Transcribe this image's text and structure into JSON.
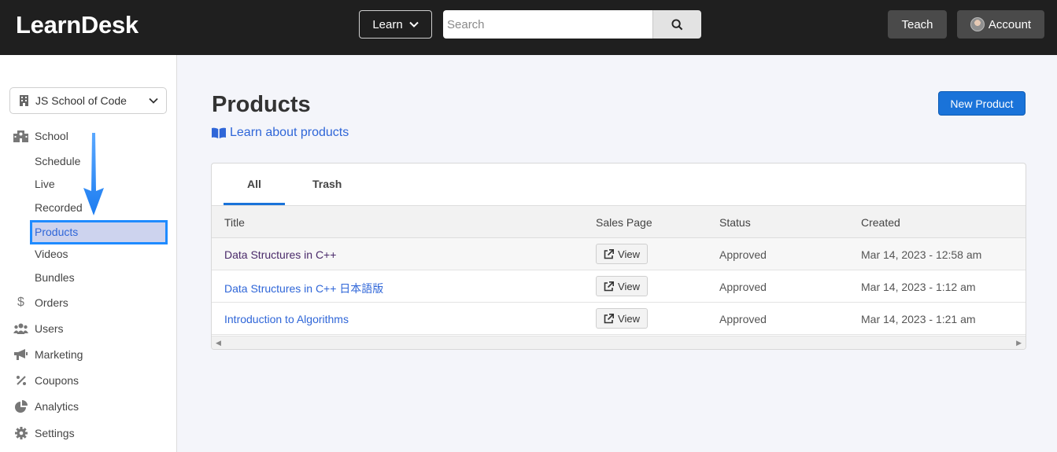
{
  "header": {
    "logo": "LearnDesk",
    "learn_label": "Learn",
    "search_placeholder": "Search",
    "teach_label": "Teach",
    "account_label": "Account"
  },
  "sidebar": {
    "school_select": "JS School of Code",
    "school_label": "School",
    "school_subitems": [
      "Schedule",
      "Live",
      "Recorded",
      "Products",
      "Videos",
      "Bundles"
    ],
    "active_item": "Products",
    "items": [
      {
        "label": "Orders",
        "icon": "dollar-icon"
      },
      {
        "label": "Users",
        "icon": "users-icon"
      },
      {
        "label": "Marketing",
        "icon": "megaphone-icon"
      },
      {
        "label": "Coupons",
        "icon": "percent-icon"
      },
      {
        "label": "Analytics",
        "icon": "pie-chart-icon"
      },
      {
        "label": "Settings",
        "icon": "gear-icon"
      }
    ]
  },
  "main": {
    "title": "Products",
    "learn_link": "Learn about products",
    "new_product_label": "New Product",
    "tabs": [
      "All",
      "Trash"
    ],
    "active_tab": "All",
    "columns": [
      "Title",
      "Sales Page",
      "Status",
      "Created"
    ],
    "rows": [
      {
        "title": "Data Structures in C++",
        "sales_page": "View",
        "status": "Approved",
        "created": "Mar 14, 2023 - 12:58 am"
      },
      {
        "title": "Data Structures in C++ 日本語版",
        "sales_page": "View",
        "status": "Approved",
        "created": "Mar 14, 2023 - 1:12 am"
      },
      {
        "title": "Introduction to Algorithms",
        "sales_page": "View",
        "status": "Approved",
        "created": "Mar 14, 2023 - 1:21 am"
      }
    ]
  },
  "colors": {
    "topbar": "#1f1f1f",
    "accent": "#1a73d9",
    "link": "#2f66d8",
    "highlight_border": "#1f8bff"
  }
}
